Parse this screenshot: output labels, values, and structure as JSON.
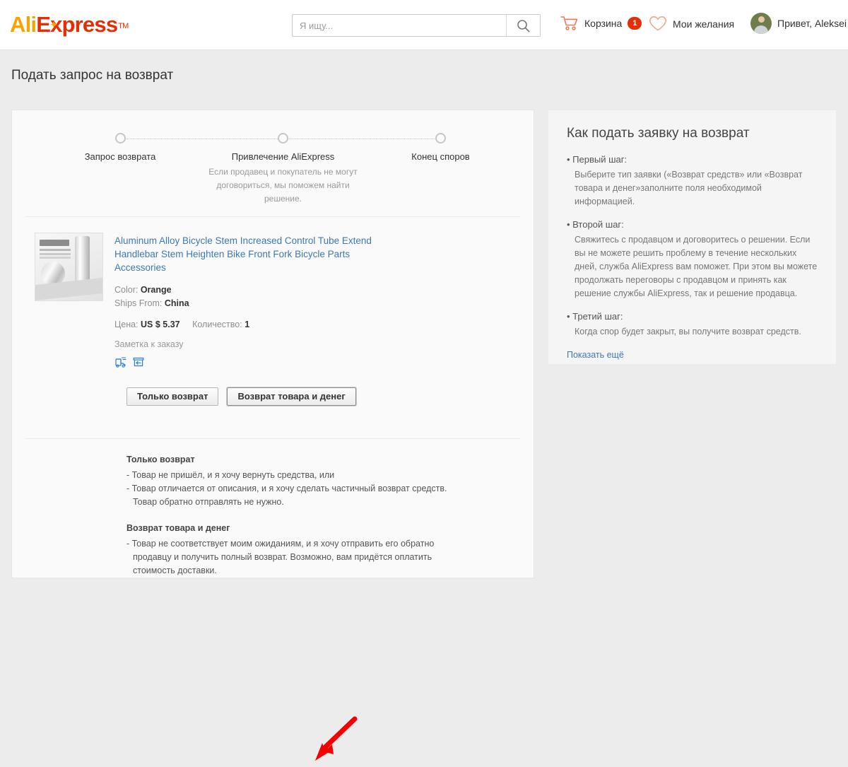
{
  "header": {
    "logo": {
      "part1": "Ali",
      "part2": "Express",
      "tm": "TM"
    },
    "search": {
      "placeholder": "Я ищу...",
      "value": "",
      "icon": "search-icon"
    },
    "cart": {
      "label": "Корзина",
      "count": "1",
      "icon": "cart-icon"
    },
    "wishlist": {
      "label": "Мои желания",
      "icon": "heart-icon"
    },
    "user": {
      "greeting": "Привет, Aleksei",
      "icon": "avatar-icon"
    }
  },
  "page": {
    "title": "Подать запрос на возврат"
  },
  "stepper": {
    "steps": [
      {
        "label": "Запрос возврата",
        "sub": ""
      },
      {
        "label": "Привлечение AliExpress",
        "sub": "Если продавец и покупатель не могут договориться, мы поможем найти решение."
      },
      {
        "label": "Конец споров",
        "sub": ""
      }
    ]
  },
  "product": {
    "title": "Aluminum Alloy Bicycle Stem Increased Control Tube Extend Handlebar Stem Heighten Bike Front Fork Bicycle Parts Accessories",
    "color_label": "Color:",
    "color_value": "Orange",
    "ships_label": "Ships From:",
    "ships_value": "China",
    "price_label": "Цена:",
    "price_value": "US $ 5.37",
    "qty_label": "Количество:",
    "qty_value": "1",
    "order_note": "Заметка к заказу",
    "icons": [
      "shipping-truck-icon",
      "return-box-icon"
    ]
  },
  "actions": {
    "refund_only": "Только возврат",
    "return_and_refund": "Возврат товара и денег"
  },
  "info": {
    "section1": {
      "heading": "Только возврат",
      "line1": "- Товар не пришёл, и я хочу вернуть средства, или",
      "line2": "- Товар отличается от описания, и я хочу сделать частичный возврат средств. Товар обратно отправлять не нужно."
    },
    "section2": {
      "heading": "Возврат товара и денег",
      "line1": "- Товар не соответствует моим ожиданиям, и я хочу отправить его обратно продавцу и получить полный возврат. Возможно, вам придётся оплатить стоимость доставки."
    }
  },
  "sidebar": {
    "title": "Как подать заявку на возврат",
    "steps": [
      {
        "head": "• Первый шаг:",
        "body": "Выберите тип заявки («Возврат средств» или «Возврат товара и денег»заполните поля необходимой информацией."
      },
      {
        "head": "• Второй шаг:",
        "body": "Свяжитесь с продавцом и договоритесь о решении. Если вы не можете решить проблему в течение нескольких дней, служба AliExpress вам поможет. При этом вы можете продолжать переговоры с продавцом и принять как решение службы AliExpress, так и решение продавца."
      },
      {
        "head": "• Третий шаг:",
        "body": "Когда спор будет закрыт, вы получите возврат средств."
      }
    ],
    "show_more": "Показать ещё"
  },
  "annotation": {
    "arrow_color": "#f50000",
    "target": "return_and_refund_button"
  },
  "colors": {
    "brand_orange": "#f7a300",
    "brand_red": "#e62e04",
    "link_blue": "#3c78b4",
    "page_bg": "#ececec"
  }
}
